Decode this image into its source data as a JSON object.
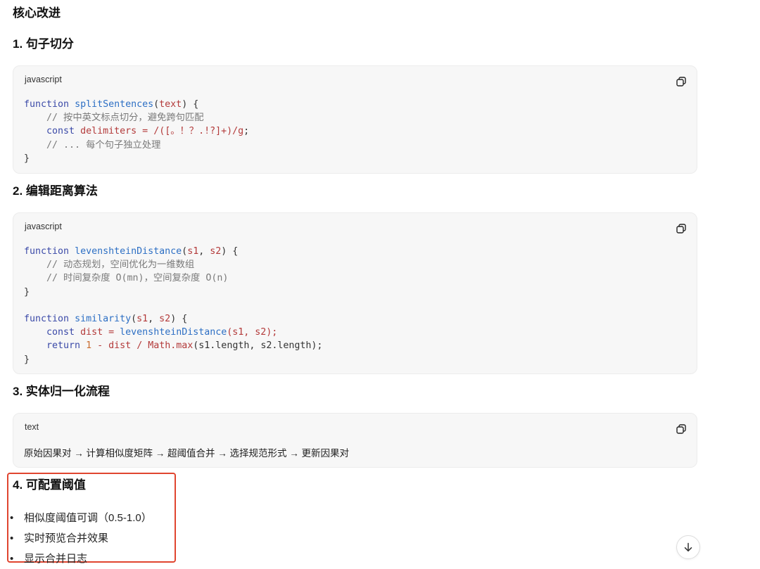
{
  "title": "核心改进",
  "sections": [
    {
      "heading": "1. 句子切分",
      "lang": "javascript",
      "tokens": {
        "fn_name": "splitSentences",
        "param": "text",
        "comment1": "// 按中英文标点切分，避免跨句匹配",
        "const_name": "delimiters",
        "regex": "/([。！？.!?]+)/g",
        "comment2": "// ... 每个句子独立处理"
      }
    },
    {
      "heading": "2. 编辑距离算法",
      "lang": "javascript",
      "tokens": {
        "fn1": "levenshteinDistance",
        "p1": "s1",
        "p2": "s2",
        "comment1": "// 动态规划，空间优化为一维数组",
        "comment2": "// 时间复杂度 O(mn)，空间复杂度 O(n)",
        "fn2": "similarity",
        "var_dist": "dist",
        "call_args": "(s1, s2);",
        "num": "1",
        "max_fn": "Math.max",
        "max_args": "(s1.length, s2.length);"
      }
    },
    {
      "heading": "3. 实体归一化流程",
      "lang": "text",
      "flow": "原始因果对 → 计算相似度矩阵 → 超阈值合并 → 选择规范形式 → 更新因果对"
    },
    {
      "heading": "4. 可配置阈值",
      "bullets": [
        "相似度阈值可调（0.5-1.0）",
        "实时预览合并效果",
        "显示合并日志"
      ]
    }
  ],
  "icons": {
    "copy": "copy-icon",
    "scroll": "arrow-down-icon"
  },
  "colors": {
    "highlight_border": "#e0452f",
    "keyword": "#3b4aa8",
    "function": "#2d6fc4",
    "param": "#b33a3a",
    "comment": "#7a7a7a",
    "number": "#c96c2e"
  }
}
